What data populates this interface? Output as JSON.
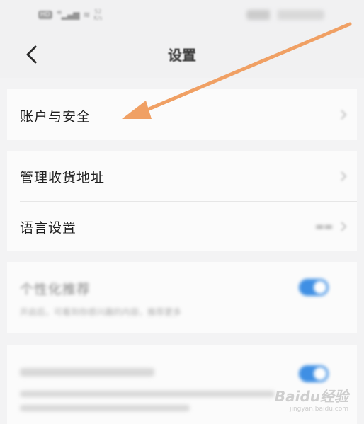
{
  "status": {
    "hd_badge": "HD",
    "network": "46",
    "speed_value": "52",
    "speed_unit": "K/s"
  },
  "nav": {
    "back_icon": "chevron-left-icon",
    "title": "设置"
  },
  "settings": {
    "account_security": "账户与安全",
    "shipping_address": "管理收货地址",
    "language": "语言设置",
    "personalized_recommendation": "个性化推荐",
    "personalized_recommendation_desc": "开启后，可看到你感兴趣的内容，推荐更多"
  },
  "colors": {
    "arrow": "#f0a064",
    "toggle_on": "#1f7de0",
    "card_bg": "#fbfbfb",
    "page_bg": "#f3f3f4"
  },
  "watermark": {
    "brand": "Baidu经验",
    "site": "jingyan.baidu.com"
  }
}
